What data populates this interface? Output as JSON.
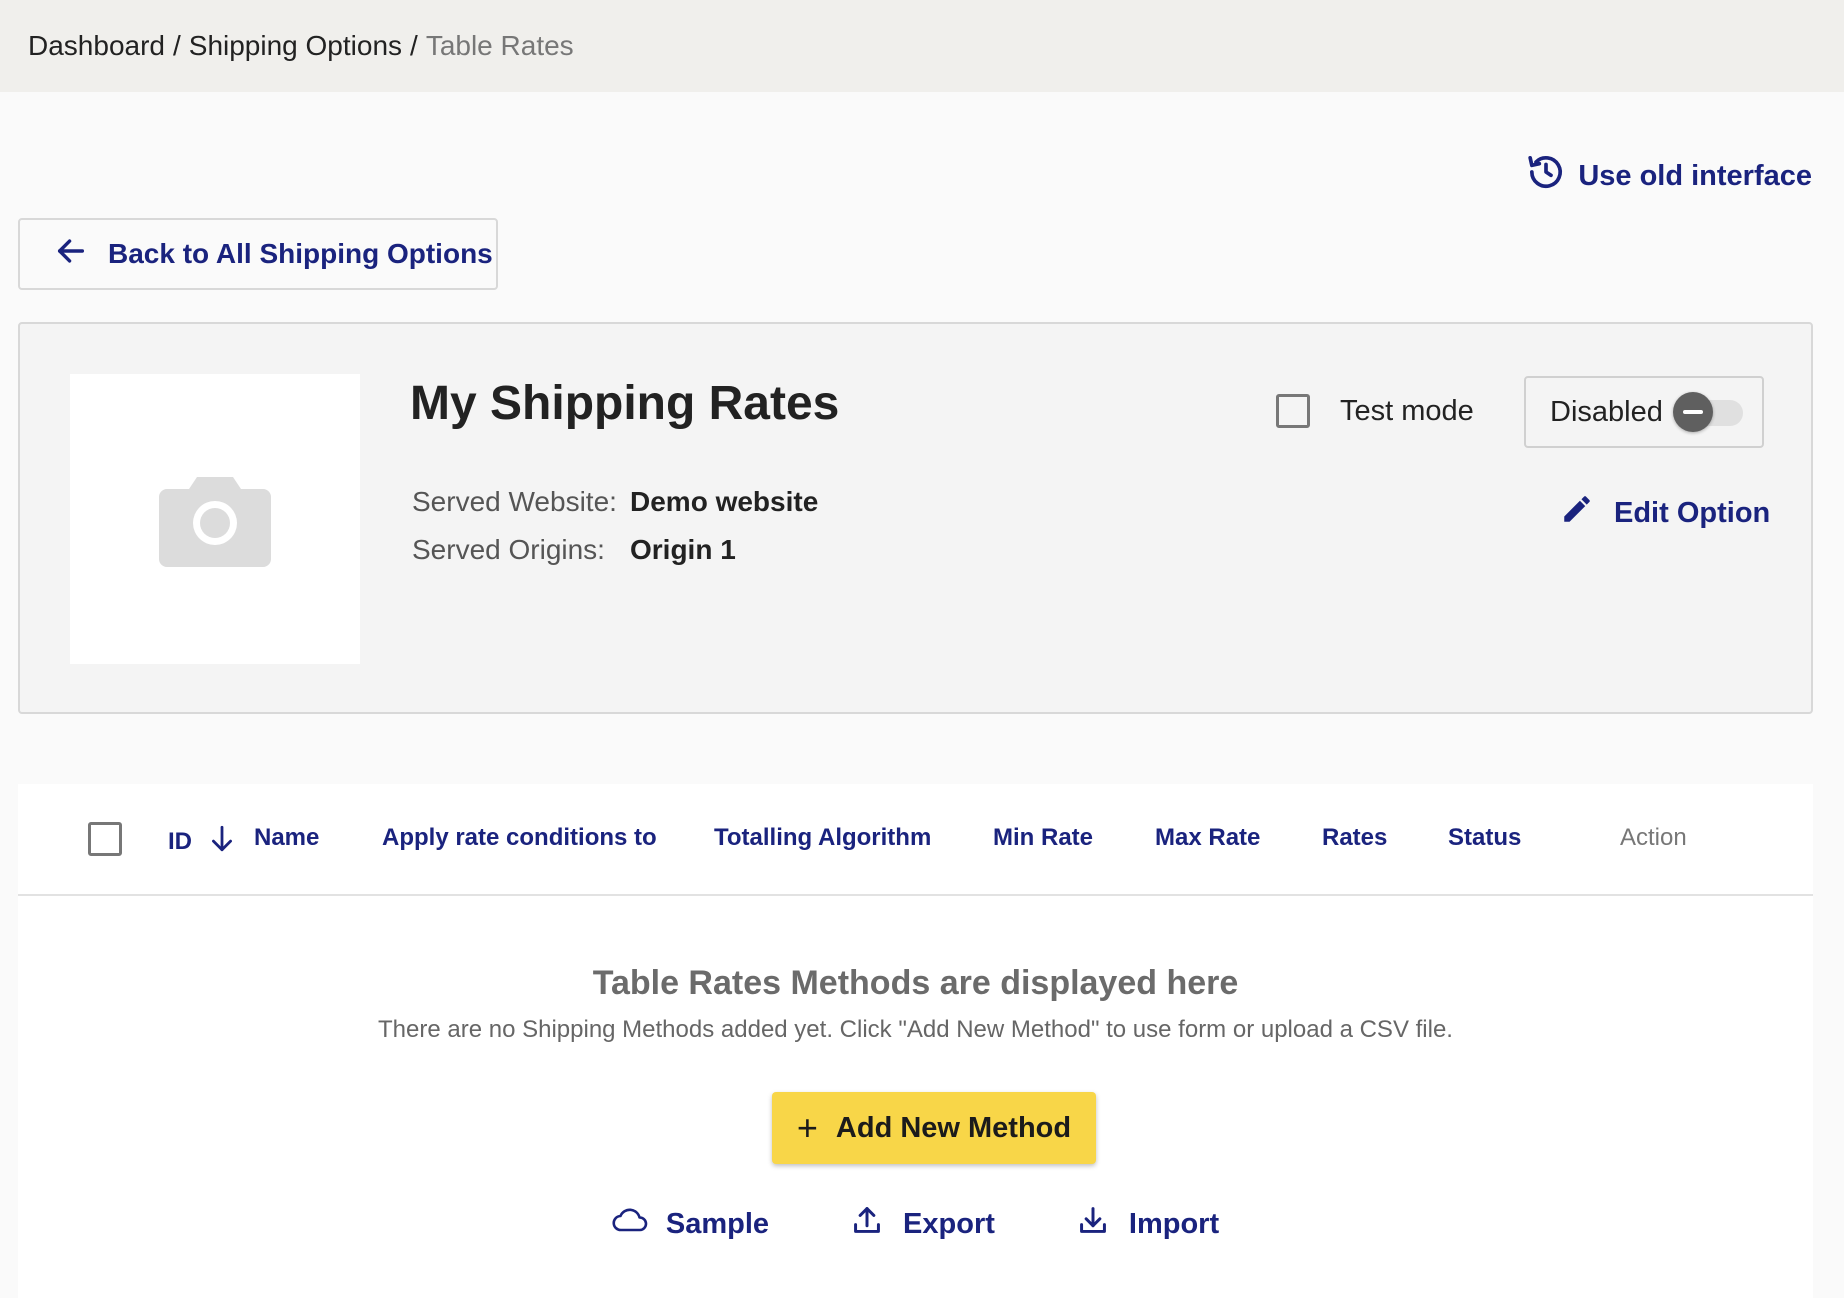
{
  "breadcrumb": {
    "items": [
      "Dashboard",
      "Shipping Options"
    ],
    "separator": "/",
    "current": "Table Rates"
  },
  "header": {
    "old_interface_label": "Use old interface"
  },
  "back_button": {
    "label": "Back to All Shipping Options"
  },
  "option": {
    "title": "My Shipping Rates",
    "served_website_label": "Served Website:",
    "served_website_value": "Demo website",
    "served_origins_label": "Served Origins:",
    "served_origins_value": "Origin 1",
    "test_mode_label": "Test mode",
    "test_mode_checked": false,
    "status_label": "Disabled",
    "edit_label": "Edit Option"
  },
  "table": {
    "columns": [
      "ID",
      "Name",
      "Apply rate conditions to",
      "Totalling Algorithm",
      "Min Rate",
      "Max Rate",
      "Rates",
      "Status",
      "Action"
    ],
    "empty_title": "Table Rates Methods are displayed here",
    "empty_subtitle": "There are no Shipping Methods added yet. Click \"Add New Method\" to use form or upload a CSV file.",
    "add_button_label": "Add New Method",
    "actions": [
      "Sample",
      "Export",
      "Import"
    ]
  },
  "colors": {
    "accent": "#1a237e",
    "primary_button": "#f8d648",
    "topbar_bg": "#f0efec"
  }
}
